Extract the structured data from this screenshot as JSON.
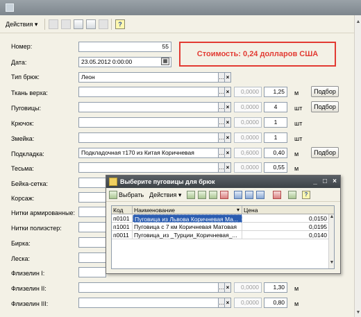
{
  "toolbar": {
    "actions_label": "Действия ▾",
    "help_label": "?"
  },
  "cost_banner": "Стоимость: 0,24 долларов США",
  "header_fields": {
    "number_label": "Номер:",
    "number_value": "55",
    "date_label": "Дата:",
    "date_value": "23.05.2012 0:00:00",
    "type_label": "Тип брюк:",
    "type_value": "Леон"
  },
  "rows": [
    {
      "label": "Ткань верха:",
      "value": "",
      "price": "0,0000",
      "qty": "1,25",
      "unit": "м",
      "button": "Подбор"
    },
    {
      "label": "Пуговицы:",
      "value": "",
      "price": "0,0000",
      "qty": "4",
      "unit": "шт",
      "button": "Подбор"
    },
    {
      "label": "Крючок:",
      "value": "",
      "price": "0,0000",
      "qty": "1",
      "unit": "шт",
      "button": ""
    },
    {
      "label": "Змейка:",
      "value": "",
      "price": "0,0000",
      "qty": "1",
      "unit": "шт",
      "button": ""
    },
    {
      "label": "Подкладка:",
      "value": "Подкладочная т170 из Китая Коричневая",
      "price": "0,6000",
      "qty": "0,40",
      "unit": "м",
      "button": "Подбор"
    },
    {
      "label": "Тесьма:",
      "value": "",
      "price": "0,0000",
      "qty": "0,55",
      "unit": "м",
      "button": ""
    },
    {
      "label": "Бейка-сетка:"
    },
    {
      "label": "Корсаж:"
    },
    {
      "label": "Нитки армированные:"
    },
    {
      "label": "Нитки полиэстер:"
    },
    {
      "label": "Бирка:"
    },
    {
      "label": "Леска:"
    },
    {
      "label": "Флизелин I:"
    },
    {
      "label": "Флизелин II:",
      "value": "",
      "price": "0,0000",
      "qty": "1,30",
      "unit": "м"
    },
    {
      "label": "Флизелин III:",
      "value": "",
      "price": "0,0000",
      "qty": "0,80",
      "unit": "м"
    }
  ],
  "dialog": {
    "title": "Выберите пуговицы для брюк",
    "select_label": "Выбрать",
    "actions_label": "Действия ▾",
    "help_label": "?",
    "columns": [
      "Код",
      "Наименование",
      "Цена"
    ],
    "sort_arrow": "▾",
    "items": [
      {
        "code": "п0101",
        "name": "Пуговица из Львова Коричневая Ма...",
        "price": "0,0150"
      },
      {
        "code": "п1001",
        "name": "Пуговица с 7 км Коричневая Матовая",
        "price": "0,0195"
      },
      {
        "code": "п0011",
        "name": "Пуговица_из _Турции_Коричневая_...",
        "price": "0,0140"
      }
    ]
  }
}
